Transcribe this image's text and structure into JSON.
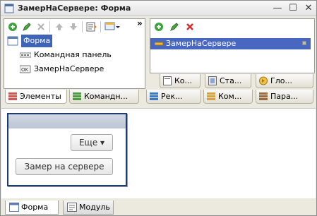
{
  "window": {
    "title": "ЗамерНаСервере: Форма",
    "controls": {
      "minimize": "—",
      "maximize": "☐",
      "close": "✕"
    }
  },
  "left_panel": {
    "toolbar": {
      "more": "»"
    },
    "tree": [
      {
        "label": "Форма",
        "icon": "form-icon",
        "selected": true
      },
      {
        "label": "Командная панель",
        "icon": "command-bar-icon",
        "selected": false
      },
      {
        "label": "ЗамерНаСервере",
        "icon": "ok-button-icon",
        "selected": false
      }
    ]
  },
  "right_panel": {
    "list": [
      {
        "label": "ЗамерНаСервере",
        "icon": "command-icon",
        "selected": true
      }
    ],
    "subtabs": [
      {
        "label": "Ко...",
        "icon": "module-icon"
      },
      {
        "label": "Ста...",
        "icon": "standard-icon"
      },
      {
        "label": "Гло...",
        "icon": "global-icon"
      }
    ]
  },
  "editor_tabs": [
    {
      "label": "Элементы",
      "active": true,
      "color": "#d9534f"
    },
    {
      "label": "Командн...",
      "active": false,
      "color": "#4a9b3c"
    },
    {
      "label": "Рек...",
      "active": false,
      "color": "#3a78c8"
    },
    {
      "label": "Ком...",
      "active": false,
      "color": "#d9a23a"
    },
    {
      "label": "Пара...",
      "active": false,
      "color": "#9b6a3c"
    }
  ],
  "preview": {
    "more_button": "Еще ▾",
    "action_button": "Замер на сервере"
  },
  "bottom_tabs": [
    {
      "label": "Форма",
      "active": true
    },
    {
      "label": "Модуль",
      "active": false
    }
  ]
}
